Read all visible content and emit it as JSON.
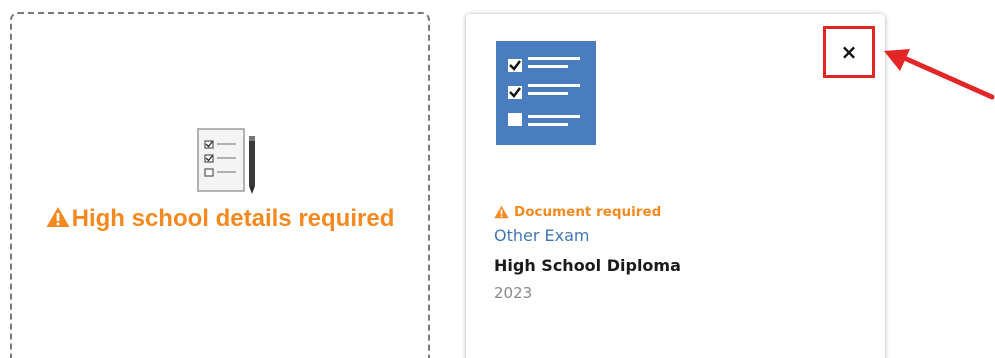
{
  "placeholder": {
    "message": "High school details required",
    "icon": "checklist-clipboard-icon"
  },
  "document_card": {
    "thumbnail_icon": "checklist-icon",
    "close_label": "×",
    "status": "Document required",
    "exam_type": "Other Exam",
    "title": "High School Diploma",
    "year": "2023"
  },
  "colors": {
    "warning": "#f5891f",
    "link_blue": "#3f78b8",
    "thumb_blue": "#4a7dc0",
    "annotation_red": "#e22525"
  }
}
